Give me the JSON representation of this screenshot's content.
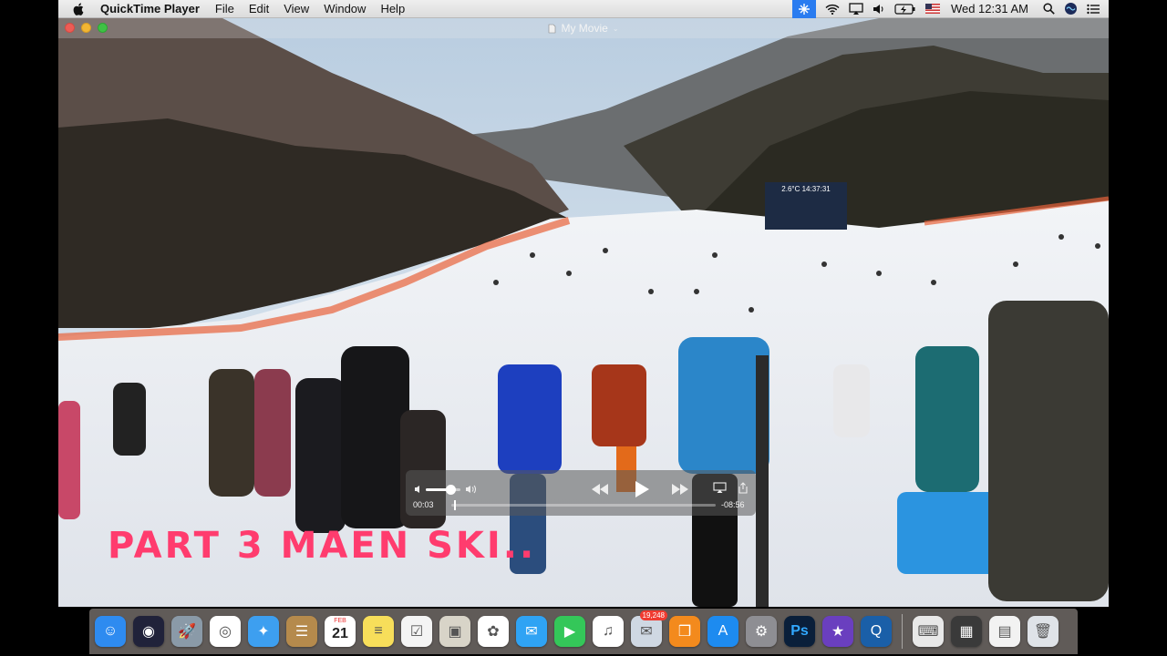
{
  "menubar": {
    "app_name": "QuickTime Player",
    "menus": [
      "File",
      "Edit",
      "View",
      "Window",
      "Help"
    ],
    "clock": "Wed 12:31 AM",
    "status_icons": [
      "network-activity-icon",
      "wifi-icon",
      "airplay-icon",
      "volume-icon",
      "battery-icon",
      "us-flag-icon",
      "spotlight-icon",
      "siri-icon",
      "notification-center-icon"
    ]
  },
  "window": {
    "title": "My Movie",
    "scoreboard": "2.6°C  14:37:31"
  },
  "controller": {
    "elapsed": "00:03",
    "remaining": "-08:56",
    "volume_level": 0.7,
    "progress": 0.01
  },
  "caption": "PART 3 MAEN SKI..",
  "dock": {
    "items": [
      {
        "name": "Finder",
        "icon": "finder-icon",
        "color": "#2e8bf0"
      },
      {
        "name": "Siri",
        "icon": "siri-icon",
        "color": "#20223a"
      },
      {
        "name": "Launchpad",
        "icon": "launchpad-rocket-icon",
        "color": "#8a9aa8"
      },
      {
        "name": "Google Chrome",
        "icon": "chrome-icon",
        "color": "#ffffff"
      },
      {
        "name": "Safari",
        "icon": "safari-compass-icon",
        "color": "#3d9ff0"
      },
      {
        "name": "Contacts",
        "icon": "contacts-book-icon",
        "color": "#b58a4c"
      },
      {
        "name": "Calendar",
        "icon": "calendar-icon",
        "color": "#ffffff",
        "month": "FEB",
        "day": "21"
      },
      {
        "name": "Notes",
        "icon": "notes-icon",
        "color": "#f7de5a"
      },
      {
        "name": "Reminders",
        "icon": "reminders-icon",
        "color": "#f4f4f4"
      },
      {
        "name": "Preview",
        "icon": "preview-icon",
        "color": "#d8d4c8"
      },
      {
        "name": "Photos",
        "icon": "photos-flower-icon",
        "color": "#ffffff"
      },
      {
        "name": "Messages",
        "icon": "messages-bubble-icon",
        "color": "#2fa3f4"
      },
      {
        "name": "FaceTime",
        "icon": "facetime-camera-icon",
        "color": "#34c759"
      },
      {
        "name": "iTunes",
        "icon": "itunes-note-icon",
        "color": "#ffffff"
      },
      {
        "name": "Mail",
        "icon": "mail-stamp-icon",
        "color": "#cfd8e3",
        "badge": "19,248"
      },
      {
        "name": "iBooks",
        "icon": "ibooks-icon",
        "color": "#f38a1d"
      },
      {
        "name": "App Store",
        "icon": "app-store-icon",
        "color": "#1d8bf0"
      },
      {
        "name": "System Preferences",
        "icon": "gear-icon",
        "color": "#8e8e93"
      },
      {
        "name": "Photoshop",
        "icon": "photoshop-icon",
        "color": "#0a1f3a",
        "label": "Ps"
      },
      {
        "name": "iMovie",
        "icon": "imovie-star-icon",
        "color": "#6a3fbf"
      },
      {
        "name": "QuickTime Player",
        "icon": "quicktime-icon",
        "color": "#1a5fa8"
      }
    ],
    "right_items": [
      {
        "name": "Keyboard Viewer",
        "icon": "keyboard-icon",
        "color": "#e8e8e8"
      },
      {
        "name": "Screen Capture",
        "icon": "screen-capture-icon",
        "color": "#3a3a3a"
      },
      {
        "name": "Document Stack",
        "icon": "document-stack-icon",
        "color": "#f2f2f2"
      },
      {
        "name": "Trash",
        "icon": "trash-icon",
        "color": "#dfe3e8"
      }
    ]
  }
}
